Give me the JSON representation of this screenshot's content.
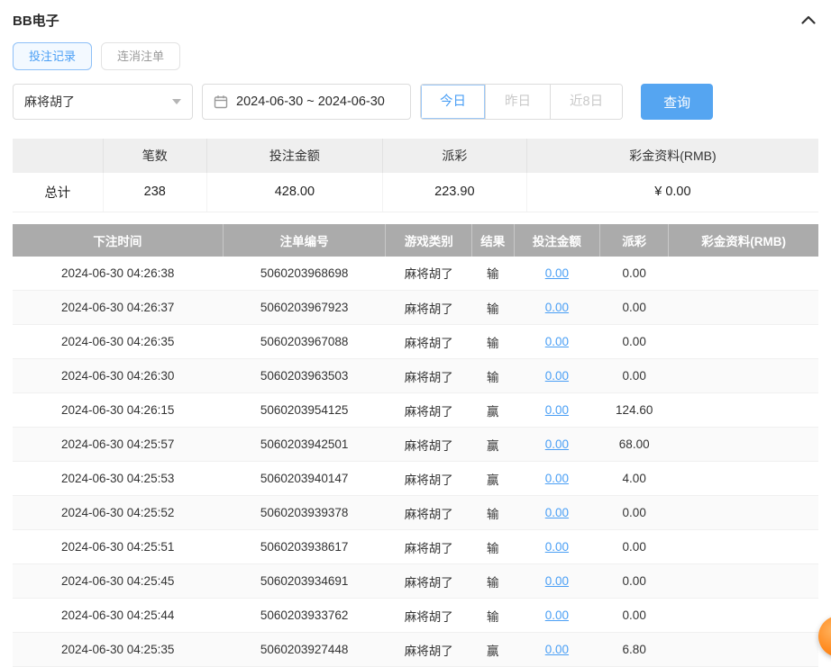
{
  "page": {
    "title": "BB电子"
  },
  "tabs": [
    {
      "label": "投注记录",
      "active": true
    },
    {
      "label": "连消注单",
      "active": false
    }
  ],
  "filters": {
    "game_select": "麻将胡了",
    "date_range": "2024-06-30 ~ 2024-06-30",
    "quick_buttons": [
      {
        "label": "今日",
        "active": true
      },
      {
        "label": "昨日",
        "active": false
      },
      {
        "label": "近8日",
        "active": false
      }
    ],
    "search_label": "查询"
  },
  "summary": {
    "headers": [
      "",
      "笔数",
      "投注金额",
      "派彩",
      "彩金资料(RMB)"
    ],
    "row": {
      "label": "总计",
      "count": "238",
      "bet": "428.00",
      "payout": "223.90",
      "bonus": "¥ 0.00"
    }
  },
  "table": {
    "headers": [
      "下注时间",
      "注单编号",
      "游戏类别",
      "结果",
      "投注金额",
      "派彩",
      "彩金资料(RMB)"
    ],
    "rows": [
      {
        "time": "2024-06-30 04:26:38",
        "order": "5060203968698",
        "game": "麻将胡了",
        "result": "输",
        "bet": "0.00",
        "payout": "0.00",
        "bonus": ""
      },
      {
        "time": "2024-06-30 04:26:37",
        "order": "5060203967923",
        "game": "麻将胡了",
        "result": "输",
        "bet": "0.00",
        "payout": "0.00",
        "bonus": ""
      },
      {
        "time": "2024-06-30 04:26:35",
        "order": "5060203967088",
        "game": "麻将胡了",
        "result": "输",
        "bet": "0.00",
        "payout": "0.00",
        "bonus": ""
      },
      {
        "time": "2024-06-30 04:26:30",
        "order": "5060203963503",
        "game": "麻将胡了",
        "result": "输",
        "bet": "0.00",
        "payout": "0.00",
        "bonus": ""
      },
      {
        "time": "2024-06-30 04:26:15",
        "order": "5060203954125",
        "game": "麻将胡了",
        "result": "赢",
        "bet": "0.00",
        "payout": "124.60",
        "bonus": ""
      },
      {
        "time": "2024-06-30 04:25:57",
        "order": "5060203942501",
        "game": "麻将胡了",
        "result": "赢",
        "bet": "0.00",
        "payout": "68.00",
        "bonus": ""
      },
      {
        "time": "2024-06-30 04:25:53",
        "order": "5060203940147",
        "game": "麻将胡了",
        "result": "赢",
        "bet": "0.00",
        "payout": "4.00",
        "bonus": ""
      },
      {
        "time": "2024-06-30 04:25:52",
        "order": "5060203939378",
        "game": "麻将胡了",
        "result": "输",
        "bet": "0.00",
        "payout": "0.00",
        "bonus": ""
      },
      {
        "time": "2024-06-30 04:25:51",
        "order": "5060203938617",
        "game": "麻将胡了",
        "result": "输",
        "bet": "0.00",
        "payout": "0.00",
        "bonus": ""
      },
      {
        "time": "2024-06-30 04:25:45",
        "order": "5060203934691",
        "game": "麻将胡了",
        "result": "输",
        "bet": "0.00",
        "payout": "0.00",
        "bonus": ""
      },
      {
        "time": "2024-06-30 04:25:44",
        "order": "5060203933762",
        "game": "麻将胡了",
        "result": "输",
        "bet": "0.00",
        "payout": "0.00",
        "bonus": ""
      },
      {
        "time": "2024-06-30 04:25:35",
        "order": "5060203927448",
        "game": "麻将胡了",
        "result": "赢",
        "bet": "0.00",
        "payout": "6.80",
        "bonus": ""
      }
    ]
  },
  "colors": {
    "accent_blue": "#4a9ff5",
    "search_button_bg": "#55a5f1",
    "table_header_gray": "#ababab",
    "float_button_orange": "#ff8a1e"
  }
}
